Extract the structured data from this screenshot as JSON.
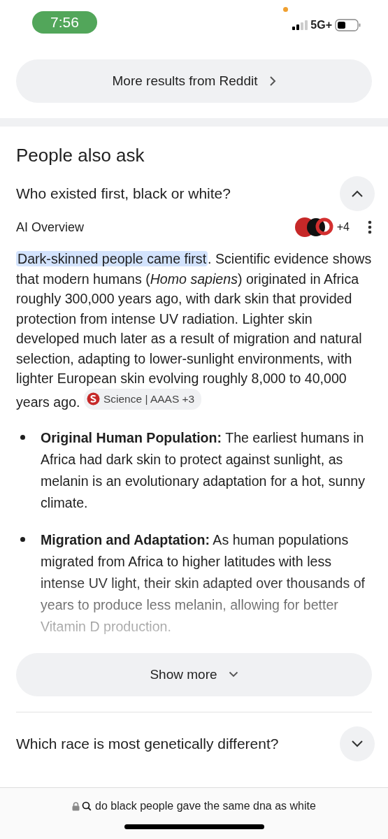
{
  "status_bar": {
    "time": "7:56",
    "network": "5G+"
  },
  "reddit_button": {
    "label": "More results from Reddit"
  },
  "people_also_ask": {
    "title": "People also ask",
    "questions": [
      {
        "text": "Who existed first, black or white?",
        "expanded": true
      },
      {
        "text": "Which race is most genetically different?",
        "expanded": false
      }
    ]
  },
  "ai_overview": {
    "title": "AI Overview",
    "source_count": "+4",
    "lead": "Dark-skinned people came first",
    "body": ". Scientific evidence shows that modern humans (*Homo sapiens*) originated in Africa roughly 300,000 years ago, with dark skin that provided protection from intense UV radiation. Lighter skin developed much later as a result of migration and natural selection, adapting to lower-sunlight environments, with lighter European skin evolving roughly 8,000 to 40,000 years ago.",
    "chip": "Science | AAAS +3",
    "bullets": [
      "**Original Human Population:** The earliest humans in Africa had dark skin to protect against sunlight, as melanin is an evolutionary adaptation for a hot, sunny climate.",
      "**Migration and Adaptation:** As human populations migrated from Africa to higher latitudes with less intense UV light, their skin adapted over thousands of years to produce less melanin, allowing for better Vitamin D production."
    ],
    "show_more": "Show more"
  },
  "address_bar": {
    "query": "do black people gave the same dna as white"
  }
}
